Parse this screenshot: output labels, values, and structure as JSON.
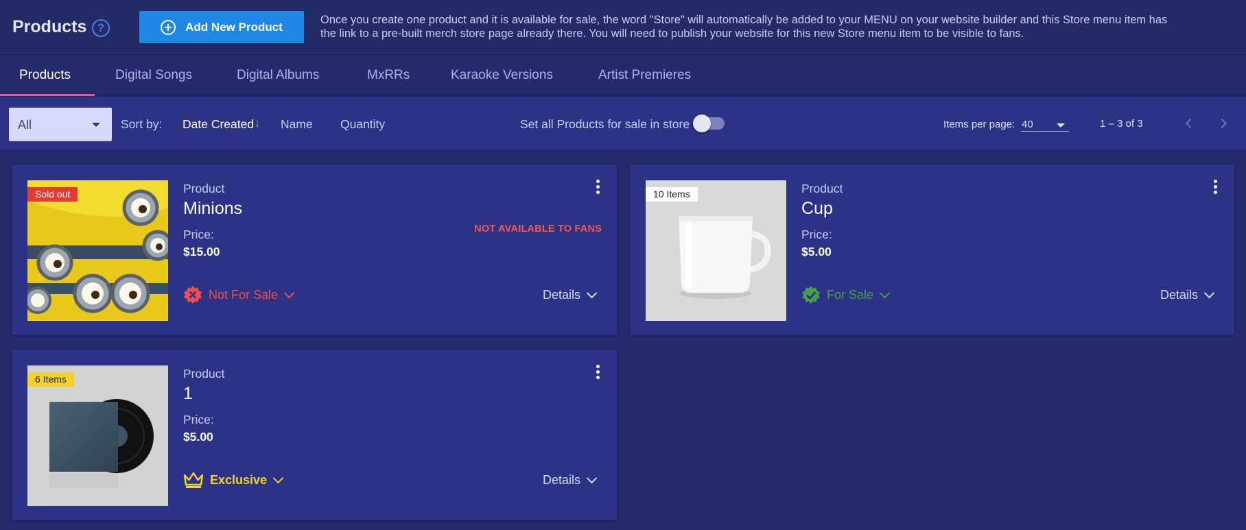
{
  "header": {
    "title": "Products",
    "add_button_label": "Add New Product",
    "info_text": "Once you create one product and it is available for sale, the word \"Store\" will automatically be added to your MENU on your website builder and this Store menu item has the link to a pre-built merch store page already there. You will need to publish your website for this new Store menu item to be visible to fans."
  },
  "tabs": [
    {
      "label": "Products",
      "active": true
    },
    {
      "label": "Digital Songs"
    },
    {
      "label": "Digital Albums"
    },
    {
      "label": "MxRRs"
    },
    {
      "label": "Karaoke Versions"
    },
    {
      "label": "Artist Premieres"
    }
  ],
  "toolbar": {
    "filter_value": "All",
    "sort_label": "Sort by:",
    "sort_options": [
      "Date Created",
      "Name",
      "Quantity"
    ],
    "sort_active": "Date Created",
    "sort_direction": "down",
    "toggle_label": "Set all Products for sale in store",
    "toggle_on": false,
    "items_per_page_label": "Items per page:",
    "items_per_page_value": "40",
    "range_text": "1 – 3 of 3"
  },
  "products": [
    {
      "type_label": "Product",
      "name": "Minions",
      "price_label": "Price:",
      "price": "$15.00",
      "badge": "Sold out",
      "badge_color": "#e53935",
      "warning": "NOT AVAILABLE TO FANS",
      "status": "Not For Sale",
      "status_color": "#ef4f47",
      "status_icon": "not-for-sale-icon",
      "details_label": "Details"
    },
    {
      "type_label": "Product",
      "name": "Cup",
      "price_label": "Price:",
      "price": "$5.00",
      "badge": "10 Items",
      "badge_color": "#ffffff",
      "warning": "",
      "status": "For Sale",
      "status_color": "#43a047",
      "status_icon": "for-sale-check-icon",
      "details_label": "Details"
    },
    {
      "type_label": "Product",
      "name": "1",
      "price_label": "Price:",
      "price": "$5.00",
      "badge": "6 Items",
      "badge_color": "#f2d22b",
      "warning": "",
      "status": "Exclusive",
      "status_color": "#f2d22b",
      "status_icon": "crown-icon",
      "details_label": "Details"
    }
  ]
}
